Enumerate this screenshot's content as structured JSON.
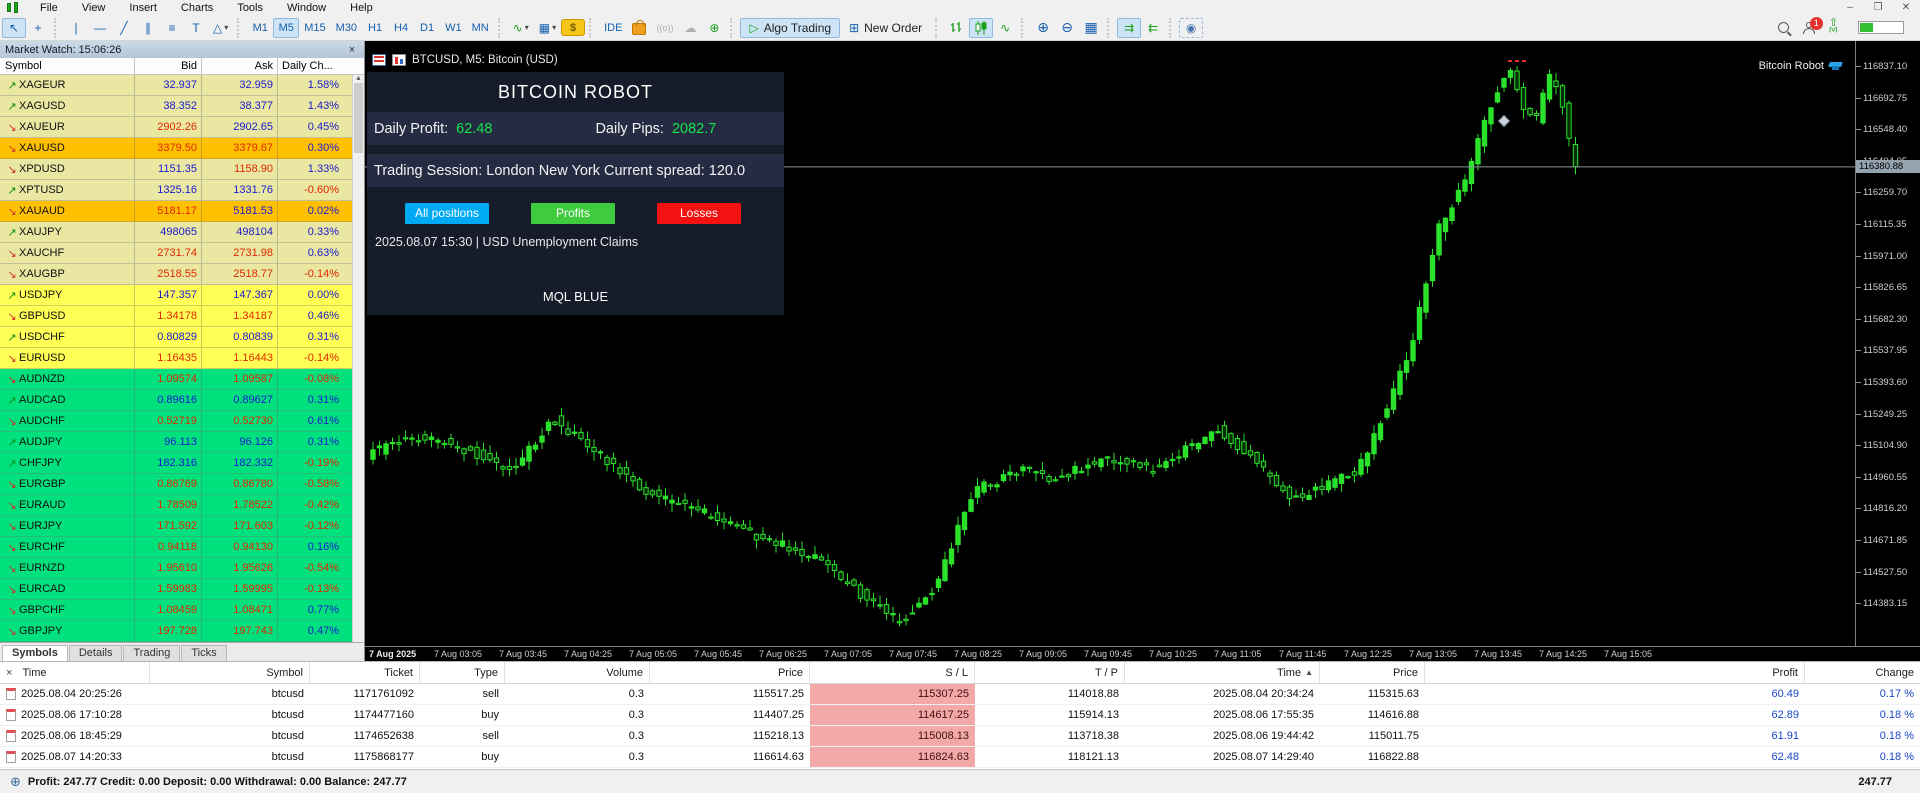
{
  "menu_bar": {
    "items": [
      "File",
      "View",
      "Insert",
      "Charts",
      "Tools",
      "Window",
      "Help"
    ]
  },
  "window_controls": {
    "minimize": "–",
    "maximize": "❐",
    "close": "✕"
  },
  "icons": {
    "up_arrow": "↗",
    "down_arrow": "↘",
    "close": "×",
    "sort_asc": "▲",
    "cursor": "↖",
    "crosshair": "+",
    "vertical_line": "∣",
    "horizontal_line": "―",
    "trendline": "╱",
    "channel": "∥",
    "equidistant": "≡",
    "text_tool": "T",
    "shapes": "△",
    "dropdown": "▾",
    "indicators": "∿",
    "templates": "▦",
    "dollar": "$",
    "signals": "((ο))",
    "cloud": "☁",
    "community": "⊕",
    "algo_play": "▷",
    "new_order_plus": "⊞",
    "bars": "☰",
    "line_chart": "∿",
    "zoom_in": "⊕",
    "zoom_out": "⊖",
    "tile": "▦",
    "shift_right": "⇉",
    "shift_left": "⇇",
    "camera": "◉",
    "scroll_up": "▲",
    "status": "⊕"
  },
  "toolbar": {
    "timeframes": [
      "M1",
      "M5",
      "M15",
      "M30",
      "H1",
      "H4",
      "D1",
      "W1",
      "MN"
    ],
    "active_timeframe": "M5",
    "ide_label": "IDE",
    "algo_trading_label": "Algo Trading",
    "new_order_label": "New Order",
    "alerts_badge": "1"
  },
  "market_watch": {
    "title": "Market Watch: 15:06:26",
    "columns": [
      "Symbol",
      "Bid",
      "Ask",
      "Daily Ch..."
    ],
    "tabs": [
      "Symbols",
      "Details",
      "Trading",
      "Ticks"
    ],
    "active_tab": "Symbols",
    "rows": [
      {
        "symbol": "XAGEUR",
        "dir": "up",
        "bid": "32.937",
        "bid_tone": "b",
        "ask": "32.959",
        "ask_tone": "b",
        "change": "1.58%",
        "chg_tone": "b",
        "group": "metal",
        "selected": false
      },
      {
        "symbol": "XAGUSD",
        "dir": "up",
        "bid": "38.352",
        "bid_tone": "b",
        "ask": "38.377",
        "ask_tone": "b",
        "change": "1.43%",
        "chg_tone": "b",
        "group": "metal",
        "selected": false
      },
      {
        "symbol": "XAUEUR",
        "dir": "down",
        "bid": "2902.26",
        "bid_tone": "r",
        "ask": "2902.65",
        "ask_tone": "b",
        "change": "0.45%",
        "chg_tone": "b",
        "group": "metal",
        "selected": false
      },
      {
        "symbol": "XAUUSD",
        "dir": "down",
        "bid": "3379.50",
        "bid_tone": "r",
        "ask": "3379.67",
        "ask_tone": "r",
        "change": "0.30%",
        "chg_tone": "b",
        "group": "metal",
        "selected": true
      },
      {
        "symbol": "XPDUSD",
        "dir": "down",
        "bid": "1151.35",
        "bid_tone": "b",
        "ask": "1158.90",
        "ask_tone": "r",
        "change": "1.33%",
        "chg_tone": "b",
        "group": "metal",
        "selected": false
      },
      {
        "symbol": "XPTUSD",
        "dir": "up",
        "bid": "1325.16",
        "bid_tone": "b",
        "ask": "1331.76",
        "ask_tone": "b",
        "change": "-0.60%",
        "chg_tone": "r",
        "group": "metal",
        "selected": false
      },
      {
        "symbol": "XAUAUD",
        "dir": "down",
        "bid": "5181.17",
        "bid_tone": "r",
        "ask": "5181.53",
        "ask_tone": "b",
        "change": "0.02%",
        "chg_tone": "b",
        "group": "metal",
        "selected": true
      },
      {
        "symbol": "XAUJPY",
        "dir": "up",
        "bid": "498065",
        "bid_tone": "b",
        "ask": "498104",
        "ask_tone": "b",
        "change": "0.33%",
        "chg_tone": "b",
        "group": "metal",
        "selected": false
      },
      {
        "symbol": "XAUCHF",
        "dir": "down",
        "bid": "2731.74",
        "bid_tone": "r",
        "ask": "2731.98",
        "ask_tone": "r",
        "change": "0.63%",
        "chg_tone": "b",
        "group": "metal",
        "selected": false
      },
      {
        "symbol": "XAUGBP",
        "dir": "down",
        "bid": "2518.55",
        "bid_tone": "r",
        "ask": "2518.77",
        "ask_tone": "r",
        "change": "-0.14%",
        "chg_tone": "r",
        "group": "metal",
        "selected": false
      },
      {
        "symbol": "USDJPY",
        "dir": "up",
        "bid": "147.357",
        "bid_tone": "b",
        "ask": "147.367",
        "ask_tone": "b",
        "change": "0.00%",
        "chg_tone": "b",
        "group": "major",
        "selected": false
      },
      {
        "symbol": "GBPUSD",
        "dir": "down",
        "bid": "1.34178",
        "bid_tone": "r",
        "ask": "1.34187",
        "ask_tone": "r",
        "change": "0.46%",
        "chg_tone": "b",
        "group": "major",
        "selected": false
      },
      {
        "symbol": "USDCHF",
        "dir": "up",
        "bid": "0.80829",
        "bid_tone": "b",
        "ask": "0.80839",
        "ask_tone": "b",
        "change": "0.31%",
        "chg_tone": "b",
        "group": "major",
        "selected": false
      },
      {
        "symbol": "EURUSD",
        "dir": "down",
        "bid": "1.16435",
        "bid_tone": "r",
        "ask": "1.16443",
        "ask_tone": "r",
        "change": "-0.14%",
        "chg_tone": "r",
        "group": "major",
        "selected": false
      },
      {
        "symbol": "AUDNZD",
        "dir": "down",
        "bid": "1.09574",
        "bid_tone": "r",
        "ask": "1.09587",
        "ask_tone": "r",
        "change": "-0.08%",
        "chg_tone": "r",
        "group": "cross",
        "selected": false
      },
      {
        "symbol": "AUDCAD",
        "dir": "up",
        "bid": "0.89616",
        "bid_tone": "b",
        "ask": "0.89627",
        "ask_tone": "b",
        "change": "0.31%",
        "chg_tone": "b",
        "group": "cross",
        "selected": false
      },
      {
        "symbol": "AUDCHF",
        "dir": "down",
        "bid": "0.52719",
        "bid_tone": "r",
        "ask": "0.52730",
        "ask_tone": "r",
        "change": "0.61%",
        "chg_tone": "b",
        "group": "cross",
        "selected": false
      },
      {
        "symbol": "AUDJPY",
        "dir": "up",
        "bid": "96.113",
        "bid_tone": "b",
        "ask": "96.126",
        "ask_tone": "b",
        "change": "0.31%",
        "chg_tone": "b",
        "group": "cross",
        "selected": false
      },
      {
        "symbol": "CHFJPY",
        "dir": "up",
        "bid": "182.316",
        "bid_tone": "b",
        "ask": "182.332",
        "ask_tone": "b",
        "change": "-0.19%",
        "chg_tone": "r",
        "group": "cross",
        "selected": false
      },
      {
        "symbol": "EURGBP",
        "dir": "down",
        "bid": "0.86769",
        "bid_tone": "r",
        "ask": "0.86780",
        "ask_tone": "r",
        "change": "-0.58%",
        "chg_tone": "r",
        "group": "cross",
        "selected": false
      },
      {
        "symbol": "EURAUD",
        "dir": "down",
        "bid": "1.78509",
        "bid_tone": "r",
        "ask": "1.78522",
        "ask_tone": "r",
        "change": "-0.42%",
        "chg_tone": "r",
        "group": "cross",
        "selected": false
      },
      {
        "symbol": "EURJPY",
        "dir": "down",
        "bid": "171.592",
        "bid_tone": "r",
        "ask": "171.603",
        "ask_tone": "r",
        "change": "-0.12%",
        "chg_tone": "r",
        "group": "cross",
        "selected": false
      },
      {
        "symbol": "EURCHF",
        "dir": "down",
        "bid": "0.94118",
        "bid_tone": "r",
        "ask": "0.94130",
        "ask_tone": "r",
        "change": "0.16%",
        "chg_tone": "b",
        "group": "cross",
        "selected": false
      },
      {
        "symbol": "EURNZD",
        "dir": "down",
        "bid": "1.95610",
        "bid_tone": "r",
        "ask": "1.95626",
        "ask_tone": "r",
        "change": "-0.54%",
        "chg_tone": "r",
        "group": "cross",
        "selected": false
      },
      {
        "symbol": "EURCAD",
        "dir": "down",
        "bid": "1.59983",
        "bid_tone": "r",
        "ask": "1.59995",
        "ask_tone": "r",
        "change": "-0.13%",
        "chg_tone": "r",
        "group": "cross",
        "selected": false
      },
      {
        "symbol": "GBPCHF",
        "dir": "down",
        "bid": "1.08459",
        "bid_tone": "r",
        "ask": "1.08471",
        "ask_tone": "r",
        "change": "0.77%",
        "chg_tone": "b",
        "group": "cross",
        "selected": false
      },
      {
        "symbol": "GBPJPY",
        "dir": "down",
        "bid": "197.728",
        "bid_tone": "r",
        "ask": "197.743",
        "ask_tone": "r",
        "change": "0.47%",
        "chg_tone": "b",
        "group": "cross",
        "selected": false
      }
    ]
  },
  "chart": {
    "title": "BTCUSD, M5:  Bitcoin (USD)",
    "watermark": "Bitcoin Robot",
    "current_price": "116380.88"
  },
  "robot_panel": {
    "title": "BITCOIN ROBOT",
    "daily_profit_label": "Daily Profit:",
    "daily_profit": "62.48",
    "daily_pips_label": "Daily Pips:",
    "daily_pips": "2082.7",
    "session_line": "Trading Session: London New York  Current spread: 120.0",
    "buttons": [
      "All positions",
      "Profits",
      "Losses"
    ],
    "news_line": "2025.08.07 15:30  |  USD    Unemployment Claims",
    "footer": "MQL BLUE"
  },
  "chart_data": {
    "type": "candlestick",
    "symbol": "BTCUSD",
    "timeframe": "M5",
    "current_price": 116380.88,
    "ylim": [
      114200,
      116900
    ],
    "price_axis_ticks": [
      "116837.10",
      "116692.75",
      "116548.40",
      "116404.05",
      "116259.70",
      "116115.35",
      "115971.00",
      "115826.65",
      "115682.30",
      "115537.95",
      "115393.60",
      "115249.25",
      "115104.90",
      "114960.55",
      "114816.20",
      "114671.85",
      "114527.50",
      "114383.15"
    ],
    "time_axis_ticks": [
      "7 Aug 2025",
      "7 Aug 03:05",
      "7 Aug 03:45",
      "7 Aug 04:25",
      "7 Aug 05:05",
      "7 Aug 05:45",
      "7 Aug 06:25",
      "7 Aug 07:05",
      "7 Aug 07:45",
      "7 Aug 08:25",
      "7 Aug 09:05",
      "7 Aug 09:45",
      "7 Aug 10:25",
      "7 Aug 11:05",
      "7 Aug 11:45",
      "7 Aug 12:25",
      "7 Aug 13:05",
      "7 Aug 13:45",
      "7 Aug 14:25",
      "7 Aug 15:05"
    ],
    "bars_approx": 186,
    "price_path": [
      {
        "x": 5,
        "p": 115060
      },
      {
        "x": 55,
        "p": 115150
      },
      {
        "x": 90,
        "p": 115120
      },
      {
        "x": 155,
        "p": 115000
      },
      {
        "x": 195,
        "p": 115230
      },
      {
        "x": 235,
        "p": 115090
      },
      {
        "x": 285,
        "p": 114900
      },
      {
        "x": 335,
        "p": 114820
      },
      {
        "x": 395,
        "p": 114700
      },
      {
        "x": 455,
        "p": 114600
      },
      {
        "x": 505,
        "p": 114420
      },
      {
        "x": 541,
        "p": 114300
      },
      {
        "x": 575,
        "p": 114450
      },
      {
        "x": 615,
        "p": 114900
      },
      {
        "x": 665,
        "p": 115000
      },
      {
        "x": 695,
        "p": 114950
      },
      {
        "x": 745,
        "p": 115050
      },
      {
        "x": 795,
        "p": 115000
      },
      {
        "x": 859,
        "p": 115180
      },
      {
        "x": 895,
        "p": 115050
      },
      {
        "x": 933,
        "p": 114860
      },
      {
        "x": 965,
        "p": 114920
      },
      {
        "x": 1000,
        "p": 115000
      },
      {
        "x": 1035,
        "p": 115350
      },
      {
        "x": 1055,
        "p": 115600
      },
      {
        "x": 1080,
        "p": 116100
      },
      {
        "x": 1105,
        "p": 116300
      },
      {
        "x": 1135,
        "p": 116700
      },
      {
        "x": 1150,
        "p": 116837
      },
      {
        "x": 1165,
        "p": 116650
      },
      {
        "x": 1178,
        "p": 116600
      },
      {
        "x": 1190,
        "p": 116800
      },
      {
        "x": 1203,
        "p": 116700
      },
      {
        "x": 1215,
        "p": 116381
      }
    ]
  },
  "history": {
    "columns": [
      "Time",
      "Symbol",
      "Ticket",
      "Type",
      "Volume",
      "Price",
      "S / L",
      "T / P",
      "Time",
      "Price",
      "Profit",
      "Change"
    ],
    "sorted_column_index": 8,
    "rows": [
      {
        "time": "2025.08.04 20:25:26",
        "symbol": "btcusd",
        "ticket": "1171761092",
        "type": "sell",
        "volume": "0.3",
        "open_price": "115517.25",
        "sl": "115307.25",
        "tp": "114018.88",
        "close_time": "2025.08.04 20:34:24",
        "close_price": "115315.63",
        "profit": "60.49",
        "change": "0.17 %"
      },
      {
        "time": "2025.08.06 17:10:28",
        "symbol": "btcusd",
        "ticket": "1174477160",
        "type": "buy",
        "volume": "0.3",
        "open_price": "114407.25",
        "sl": "114617.25",
        "tp": "115914.13",
        "close_time": "2025.08.06 17:55:35",
        "close_price": "114616.88",
        "profit": "62.89",
        "change": "0.18 %"
      },
      {
        "time": "2025.08.06 18:45:29",
        "symbol": "btcusd",
        "ticket": "1174652638",
        "type": "sell",
        "volume": "0.3",
        "open_price": "115218.13",
        "sl": "115008.13",
        "tp": "113718.38",
        "close_time": "2025.08.06 19:44:42",
        "close_price": "115011.75",
        "profit": "61.91",
        "change": "0.18 %"
      },
      {
        "time": "2025.08.07 14:20:33",
        "symbol": "btcusd",
        "ticket": "1175868177",
        "type": "buy",
        "volume": "0.3",
        "open_price": "116614.63",
        "sl": "116824.63",
        "tp": "118121.13",
        "close_time": "2025.08.07 14:29:40",
        "close_price": "116822.88",
        "profit": "62.48",
        "change": "0.18 %"
      }
    ]
  },
  "status_bar": {
    "summary": "Profit: 247.77   Credit: 0.00   Deposit: 0.00   Withdrawal: 0.00   Balance: 247.77",
    "right_value": "247.77"
  }
}
